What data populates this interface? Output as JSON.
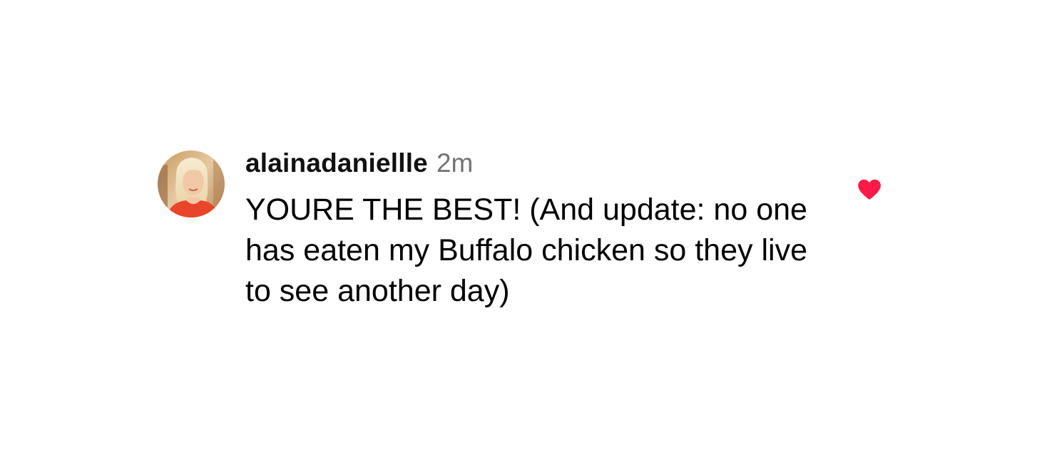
{
  "comment": {
    "username": "alainadaniellle",
    "time_ago": "2m",
    "text": "YOURE THE BEST! (And update: no one has eaten my Buffalo chicken so they live to see another day)",
    "liked": true
  },
  "icons": {
    "avatar": "user-avatar-photo",
    "like": "heart-icon"
  },
  "colors": {
    "heart": "#ff1a47",
    "username": "#111111",
    "timestamp": "#737373",
    "text": "#000000",
    "background": "#ffffff"
  }
}
